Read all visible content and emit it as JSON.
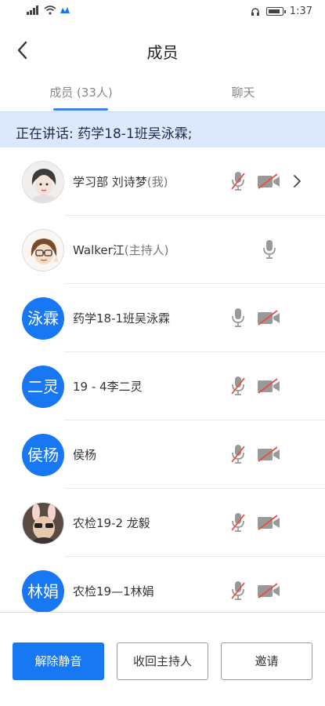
{
  "status_bar": {
    "network": "4G",
    "time": "1:37"
  },
  "header": {
    "title": "成员"
  },
  "tabs": [
    {
      "label": "成员 (33人)",
      "active": true
    },
    {
      "label": "聊天",
      "active": false
    }
  ],
  "speaking": {
    "text": "正在讲话: 药学18-1班吴泳霖;"
  },
  "members": [
    {
      "name": "学习部 刘诗梦",
      "suffix": "(我)",
      "avatar_type": "photo",
      "avatar_text": "",
      "mic": "muted",
      "camera": "off",
      "has_chevron": true
    },
    {
      "name": "Walker江",
      "suffix": "(主持人)",
      "avatar_type": "photo",
      "avatar_text": "",
      "mic": "on",
      "camera": "none",
      "has_chevron": false
    },
    {
      "name": "药学18-1班吴泳霖",
      "suffix": "",
      "avatar_type": "text",
      "avatar_text": "泳霖",
      "mic": "on",
      "camera": "off",
      "has_chevron": false
    },
    {
      "name": "19 - 4李二灵",
      "suffix": "",
      "avatar_type": "text",
      "avatar_text": "二灵",
      "mic": "muted",
      "camera": "off",
      "has_chevron": false
    },
    {
      "name": "侯杨",
      "suffix": "",
      "avatar_type": "text",
      "avatar_text": "侯杨",
      "mic": "muted",
      "camera": "off",
      "has_chevron": false
    },
    {
      "name": "农检19-2 龙毅",
      "suffix": "",
      "avatar_type": "photo",
      "avatar_text": "",
      "mic": "muted",
      "camera": "off",
      "has_chevron": false
    },
    {
      "name": "农检19—1林娟",
      "suffix": "",
      "avatar_type": "text",
      "avatar_text": "林娟",
      "mic": "muted",
      "camera": "off",
      "has_chevron": false
    }
  ],
  "buttons": {
    "unmute": "解除静音",
    "revoke_host": "收回主持人",
    "invite": "邀请"
  },
  "colors": {
    "accent": "#1877f2",
    "banner": "#dce8fb",
    "muted_slash": "#e8503a"
  }
}
